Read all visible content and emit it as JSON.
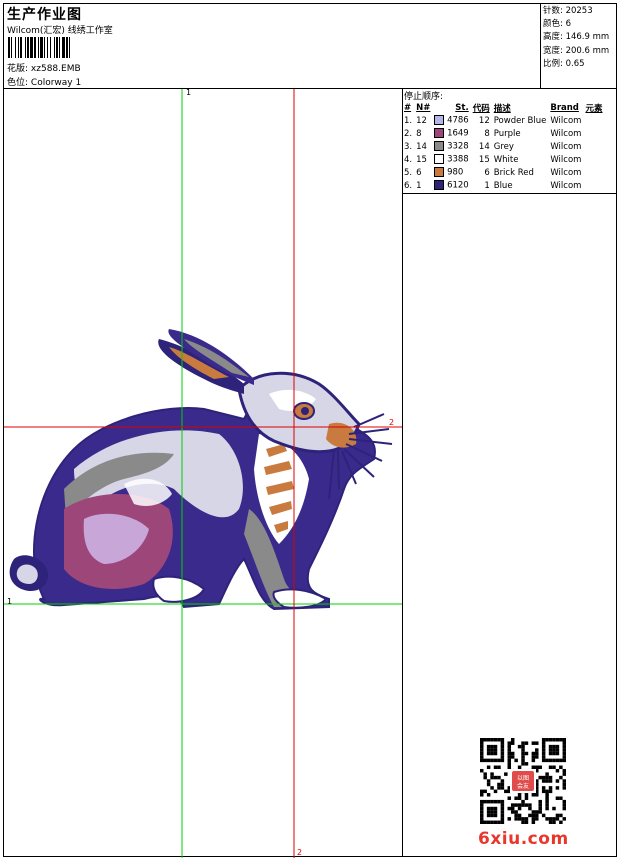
{
  "header": {
    "title": "生产作业图",
    "company": "Wilcom(汇宏) 线绣工作室",
    "design_label": "花版:",
    "design_value": "xz588.EMB",
    "colorway_label": "色位:",
    "colorway_value": "Colorway 1"
  },
  "stats": [
    {
      "label": "针数:",
      "value": "20253"
    },
    {
      "label": "颜色:",
      "value": "6"
    },
    {
      "label": "高度:",
      "value": "146.9 mm"
    },
    {
      "label": "宽度:",
      "value": "200.6 mm"
    },
    {
      "label": "比例:",
      "value": "0.65"
    }
  ],
  "stop_sequence": {
    "title": "停止顺序:",
    "headers": [
      "#",
      "N#",
      "St.",
      "代码",
      "描述",
      "Brand",
      "元素"
    ],
    "rows": [
      {
        "index": "1.",
        "n": "12",
        "color": "#b4b6e6",
        "st": "4786",
        "code": "12",
        "desc": "Powder Blue",
        "brand": "Wilcom"
      },
      {
        "index": "2.",
        "n": "8",
        "color": "#9c4679",
        "st": "1649",
        "code": "8",
        "desc": "Purple",
        "brand": "Wilcom"
      },
      {
        "index": "3.",
        "n": "14",
        "color": "#8a8a8a",
        "st": "3328",
        "code": "14",
        "desc": "Grey",
        "brand": "Wilcom"
      },
      {
        "index": "4.",
        "n": "15",
        "color": "#ffffff",
        "st": "3388",
        "code": "15",
        "desc": "White",
        "brand": "Wilcom"
      },
      {
        "index": "5.",
        "n": "6",
        "color": "#c97b3f",
        "st": "980",
        "code": "6",
        "desc": "Brick Red",
        "brand": "Wilcom"
      },
      {
        "index": "6.",
        "n": "1",
        "color": "#2d237a",
        "st": "6120",
        "code": "1",
        "desc": "Blue",
        "brand": "Wilcom"
      }
    ]
  },
  "guides": {
    "green_top": "1",
    "green_left": "1",
    "red_right": "2",
    "red_bottom": "2"
  },
  "watermark": "6xiu.com",
  "seal_text": "以图会友"
}
